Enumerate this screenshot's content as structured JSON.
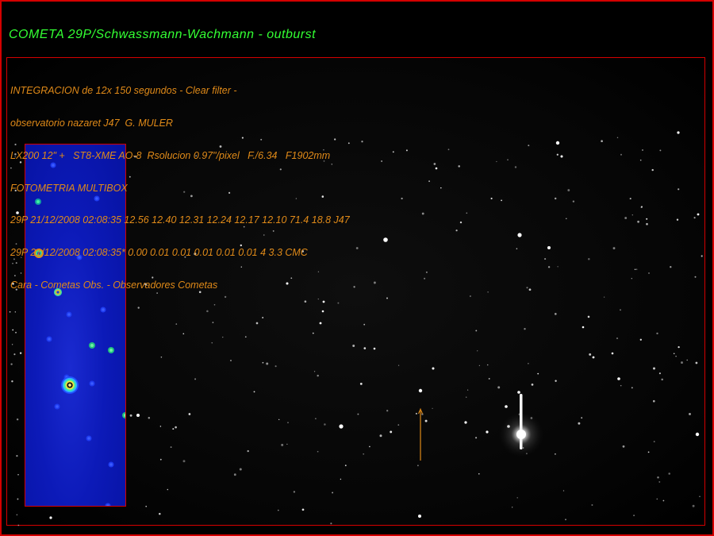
{
  "title": "COMETA  29P/Schwassmann-Wachmann - outburst",
  "info_lines": [
    "INTEGRACION de 12x 150 segundos - Clear filter -",
    "observatorio nazaret J47  G. MULER",
    "LX200 12\" +   ST8-XME AO-8  Rsolucion 0.97\"/pixel   F./6.34   F1902mm",
    "FOTOMETRIA MULTIBOX",
    "29P 21/12/2008 02:08:35 12.56 12.40 12.31 12.24 12.17 12.10 71.4 18.8 J47",
    "29P 21/12/2008 02:08:35* 0.00 0.01 0.01 0.01 0.01 0.01 4 3.3 CMC",
    "Cara - Cometas Obs. - Observadores Cometas"
  ],
  "colors": {
    "title": "#33ff33",
    "info_text": "#e08a18",
    "border": "#d40000",
    "background": "#000000",
    "inset_blue": "#0c1ab8",
    "arrow": "#e08a18"
  }
}
